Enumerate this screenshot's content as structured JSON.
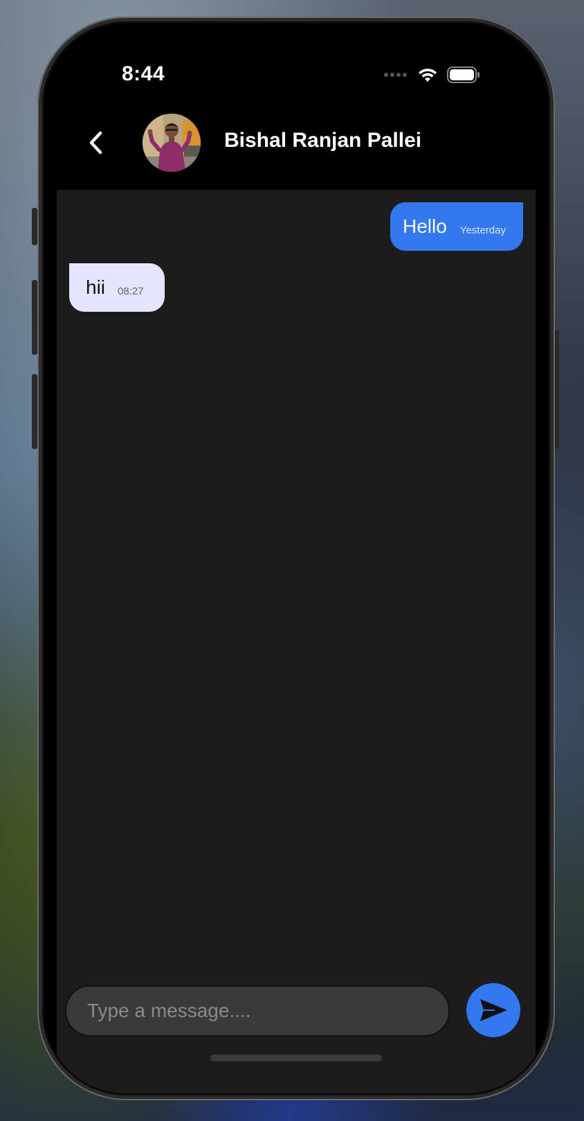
{
  "status_bar": {
    "time": "8:44"
  },
  "header": {
    "contact_name": "Bishal Ranjan Pallei"
  },
  "messages": [
    {
      "direction": "outgoing",
      "text": "Hello",
      "time": "Yesterday"
    },
    {
      "direction": "incoming",
      "text": "hii",
      "time": "08:27"
    }
  ],
  "composer": {
    "placeholder": "Type a message....",
    "value": ""
  },
  "colors": {
    "accent": "#3478f0",
    "incoming_bubble": "#e4e6ff",
    "chat_background": "#1c1c1c"
  },
  "icons": {
    "back": "chevron-left-icon",
    "send": "send-icon",
    "wifi": "wifi-icon",
    "battery": "battery-icon",
    "signal": "signal-icon"
  }
}
